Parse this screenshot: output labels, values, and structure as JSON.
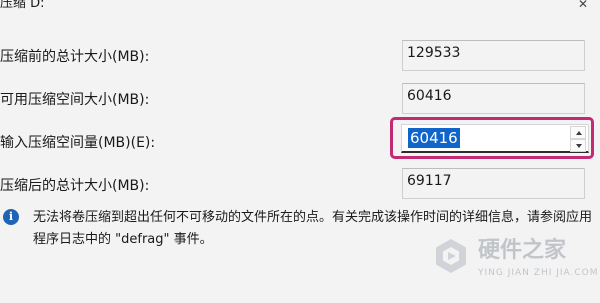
{
  "dialog": {
    "title": "压缩 D:",
    "close_icon": "close-icon"
  },
  "fields": {
    "total_before": {
      "label": "压缩前的总计大小(MB):",
      "value": "129533"
    },
    "available": {
      "label": "可用压缩空间大小(MB):",
      "value": "60416"
    },
    "amount": {
      "label": "输入压缩空间量(MB)(E):",
      "value": "60416"
    },
    "total_after": {
      "label": "压缩后的总计大小(MB):",
      "value": "69117"
    }
  },
  "info": {
    "icon": "info-icon",
    "text": "无法将卷压缩到超出任何不可移动的文件所在的点。有关完成该操作时间的详细信息，请参阅应用程序日志中的 \"defrag\" 事件。"
  },
  "watermark": {
    "main": "硬件之家",
    "sub": "YING JIAN ZHI JIA.COM"
  },
  "colors": {
    "highlight_border": "#c22a73",
    "selection": "#0f65c9",
    "info_icon": "#1f63b6"
  }
}
